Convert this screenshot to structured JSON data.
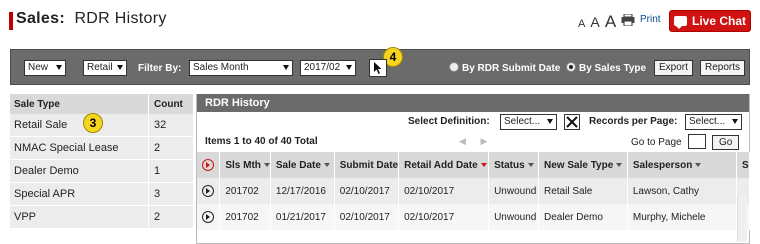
{
  "header": {
    "section": "Sales",
    "separator": ":",
    "title": "RDR History",
    "font_sizes": [
      "A",
      "A",
      "A"
    ],
    "print_label": "Print",
    "live_chat_label": "Live Chat"
  },
  "toolbar": {
    "type_select": "New",
    "category_select": "Retail",
    "filter_by_label": "Filter By:",
    "filter_select": "Sales Month",
    "month_select": "2017/02",
    "radio_submit_label": "By RDR Submit Date",
    "radio_sales_type_label": "By Sales Type",
    "export_label": "Export",
    "reports_label": "Reports",
    "callout_4": "4"
  },
  "left_panel": {
    "col_sale_type": "Sale Type",
    "col_count": "Count",
    "callout_3": "3",
    "rows": [
      {
        "type": "Retail Sale",
        "count": "32"
      },
      {
        "type": "NMAC Special Lease",
        "count": "2"
      },
      {
        "type": "Dealer Demo",
        "count": "1"
      },
      {
        "type": "Special APR",
        "count": "3"
      },
      {
        "type": "VPP",
        "count": "2"
      }
    ]
  },
  "right_panel": {
    "title": "RDR History",
    "select_definition_label": "Select Definition:",
    "select_definition_value": "Select...",
    "records_per_page_label": "Records per Page:",
    "records_per_page_value": "Select...",
    "items_total": "Items 1 to 40 of 40 Total",
    "pager_prev": "◀",
    "pager_next": "▶",
    "go_to_page_label": "Go to Page",
    "go_label": "Go",
    "columns": [
      "Sls Mth",
      "Sale Date",
      "Submit Date",
      "Retail Add Date",
      "Status",
      "New Sale Type",
      "Salesperson",
      "S"
    ],
    "rows": [
      {
        "sls_mth": "201702",
        "sale_date": "12/17/2016",
        "submit_date": "02/10/2017",
        "retail_add_date": "02/10/2017",
        "status": "Unwound",
        "new_sale_type": "Retail Sale",
        "salesperson": "Lawson, Cathy"
      },
      {
        "sls_mth": "201702",
        "sale_date": "01/21/2017",
        "submit_date": "02/10/2017",
        "retail_add_date": "02/10/2017",
        "status": "Unwound",
        "new_sale_type": "Dealer Demo",
        "salesperson": "Murphy, Michele"
      }
    ]
  }
}
